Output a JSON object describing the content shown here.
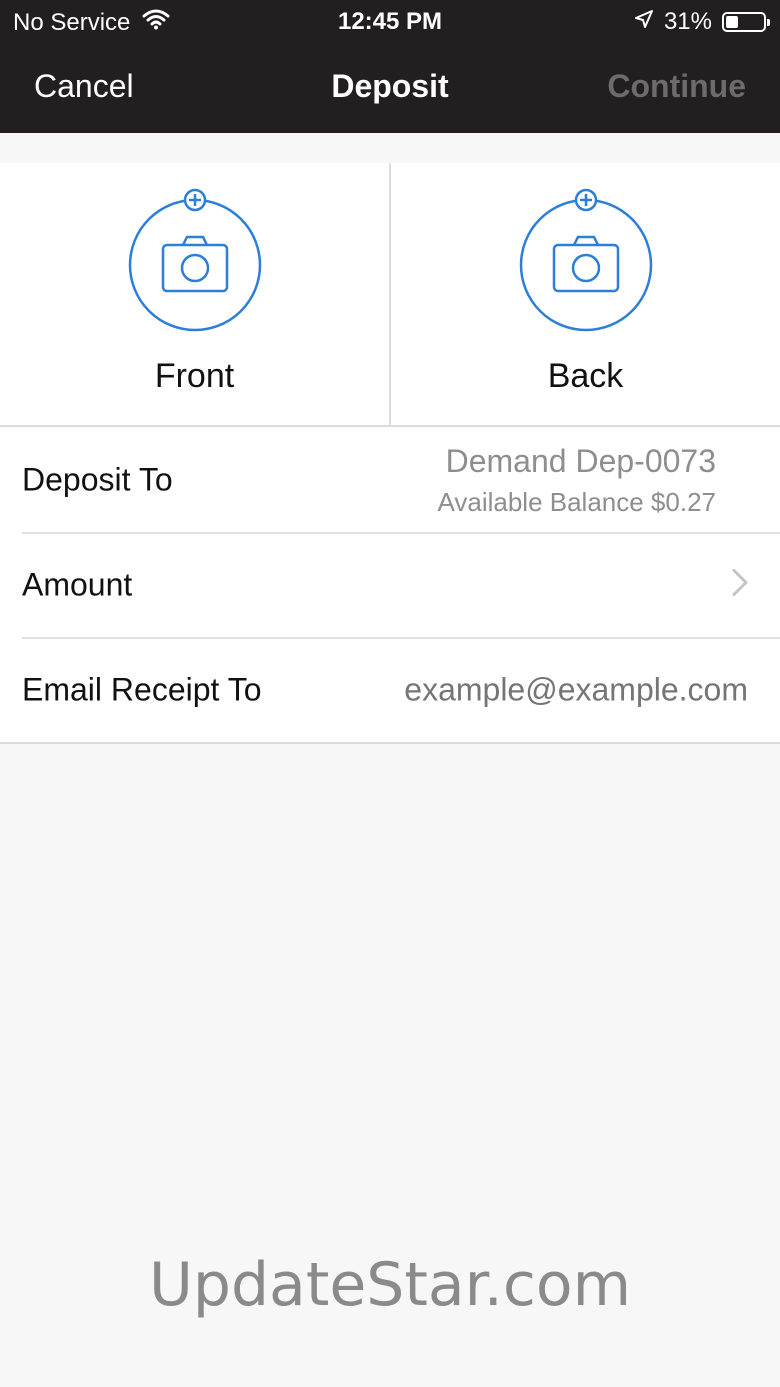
{
  "status_bar": {
    "carrier": "No Service",
    "time": "12:45 PM",
    "battery": "31%",
    "battery_level": 0.31
  },
  "nav": {
    "cancel": "Cancel",
    "title": "Deposit",
    "continue": "Continue"
  },
  "captures": {
    "front_label": "Front",
    "back_label": "Back",
    "accent_color": "#2b7fd9"
  },
  "form": {
    "deposit_to_label": "Deposit To",
    "deposit_account": "Demand Dep-0073",
    "available_balance": "Available Balance $0.27",
    "amount_label": "Amount",
    "email_label": "Email Receipt To",
    "email_placeholder": "example@example.com"
  },
  "watermark": "UpdateStar.com"
}
